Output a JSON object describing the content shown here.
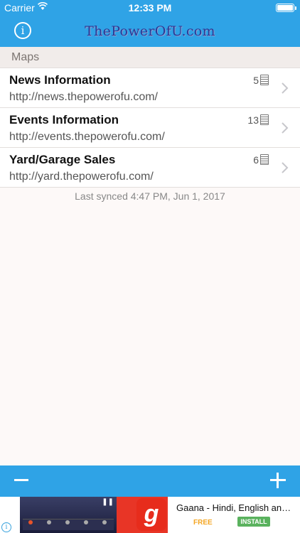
{
  "status_bar": {
    "carrier": "Carrier",
    "time": "12:33 PM"
  },
  "nav": {
    "info_glyph": "i",
    "logo_text": "ThePowerOfU.com"
  },
  "section": {
    "header": "Maps"
  },
  "rows": [
    {
      "title": "News Information",
      "url": "http://news.thepowerofu.com/",
      "count": "5"
    },
    {
      "title": "Events Information",
      "url": "http://events.thepowerofu.com/",
      "count": "13"
    },
    {
      "title": "Yard/Garage Sales",
      "url": "http://yard.thepowerofu.com/",
      "count": "6"
    }
  ],
  "footer": {
    "synced_text": "Last synced 4:47 PM, Jun 1, 2017"
  },
  "ad": {
    "app_logo_letter": "g",
    "app_title": "Gaana - Hindi, English and ...",
    "price_label": "FREE",
    "install_label": "INSTALL",
    "adchoice_glyph": "i"
  },
  "colors": {
    "primary": "#2fa3e6",
    "background": "#fdf9f8"
  },
  "icons": [
    "wifi-icon",
    "battery-icon",
    "info-icon",
    "document-icon",
    "chevron-right-icon",
    "minus-icon",
    "plus-icon"
  ]
}
